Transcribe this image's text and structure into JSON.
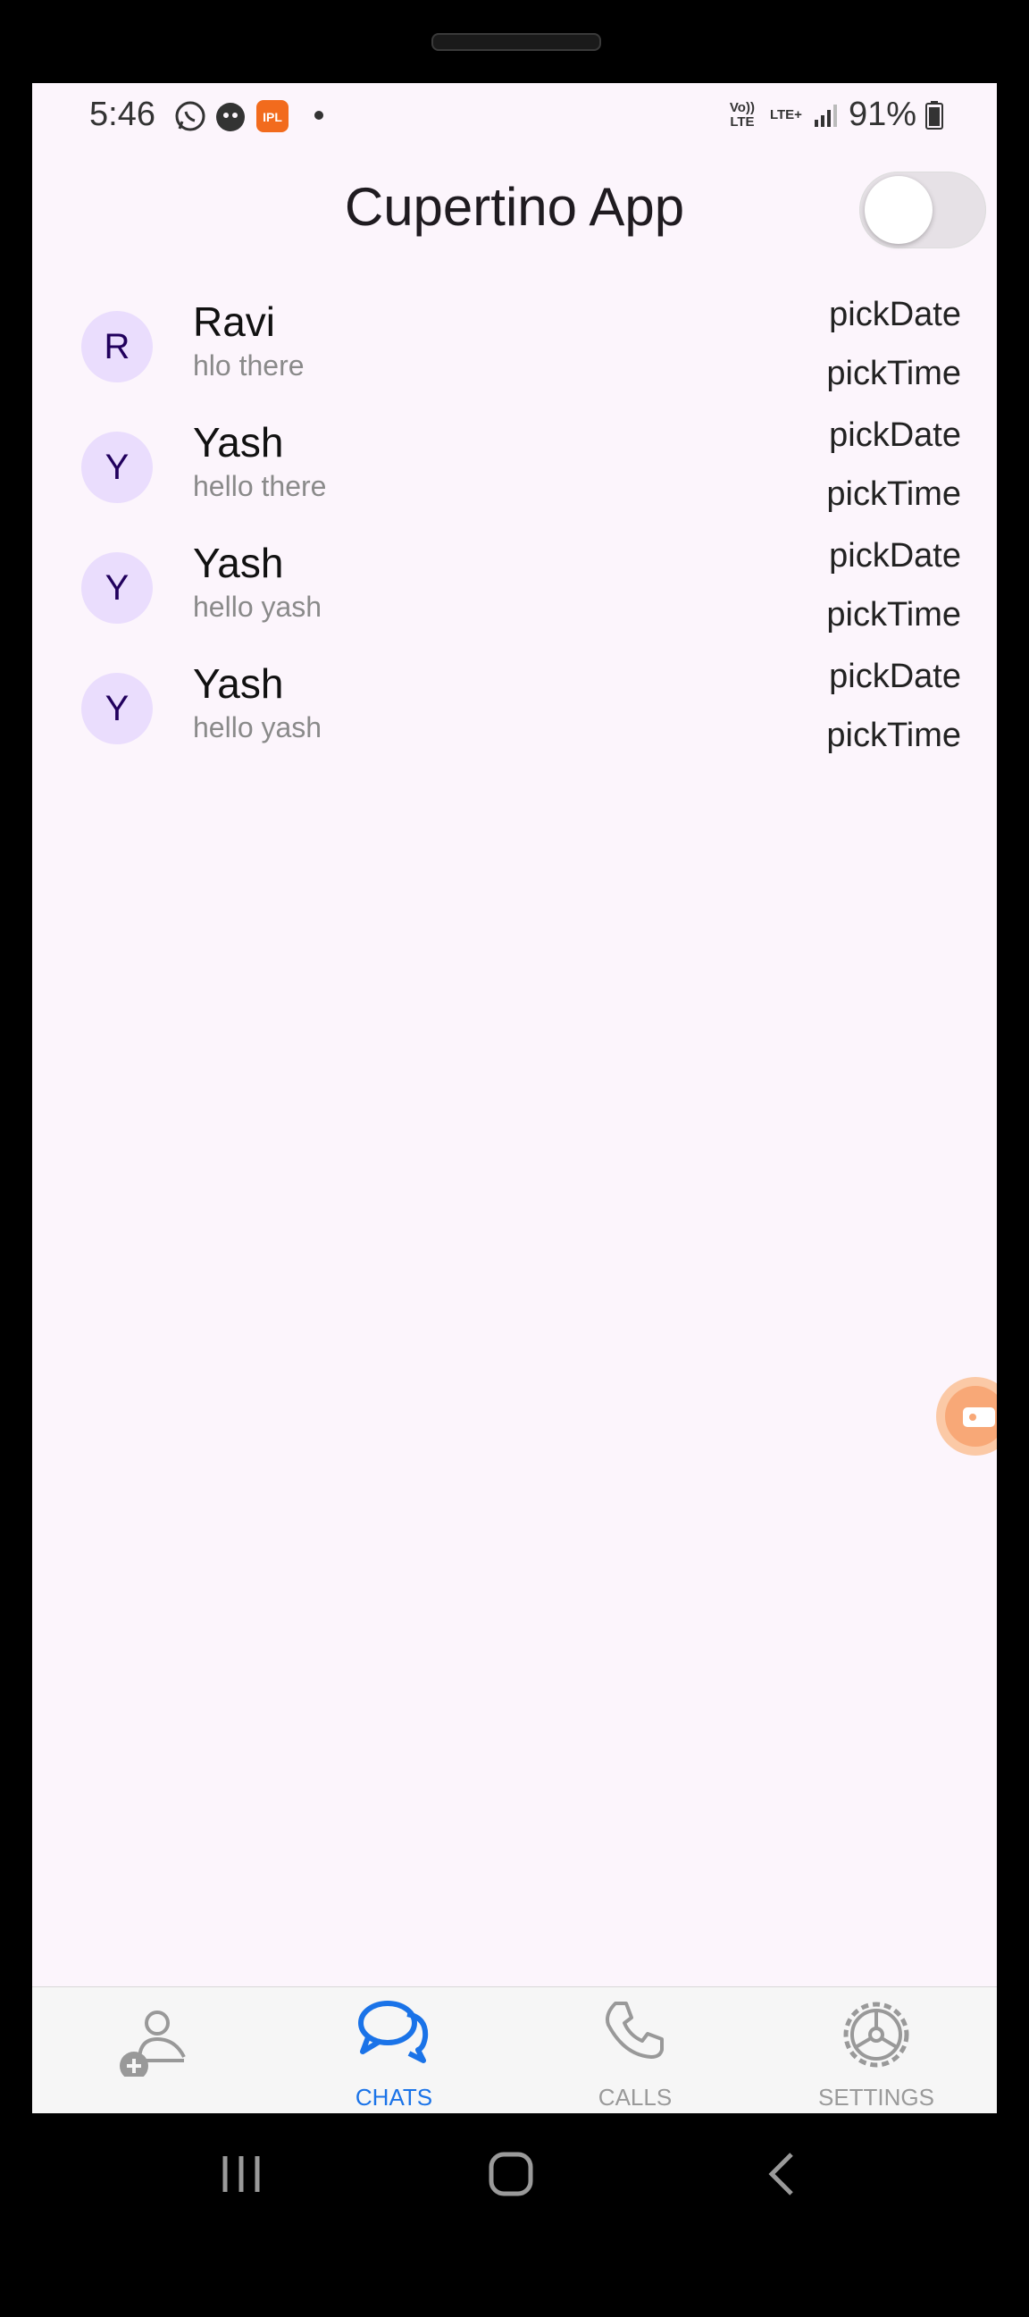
{
  "status_bar": {
    "time": "5:46",
    "icons": [
      "whatsapp-icon",
      "app-notification-icon",
      "ipl-app-icon"
    ],
    "network_1": "Vo)) LTE",
    "network_2": "LTE+",
    "battery": "91%"
  },
  "app_bar": {
    "title": "Cupertino App",
    "toggle_on": false
  },
  "chats": [
    {
      "initial": "R",
      "name": "Ravi",
      "message": "hlo there",
      "date_label": "pickDate",
      "time_label": "pickTime"
    },
    {
      "initial": "Y",
      "name": "Yash",
      "message": "hello there",
      "date_label": "pickDate",
      "time_label": "pickTime"
    },
    {
      "initial": "Y",
      "name": "Yash",
      "message": "hello yash",
      "date_label": "pickDate",
      "time_label": "pickTime"
    },
    {
      "initial": "Y",
      "name": "Yash",
      "message": "hello yash",
      "date_label": "pickDate",
      "time_label": "pickTime"
    }
  ],
  "tabs": [
    {
      "label": "",
      "icon": "add-person-icon",
      "active": false
    },
    {
      "label": "CHATS",
      "icon": "chat-bubbles-icon",
      "active": true
    },
    {
      "label": "CALLS",
      "icon": "phone-icon",
      "active": false
    },
    {
      "label": "SETTINGS",
      "icon": "gear-icon",
      "active": false
    }
  ],
  "colors": {
    "background": "#fcf5fc",
    "accent": "#1a73e8",
    "avatar_bg": "#eaddfd",
    "avatar_text": "#21005d",
    "inactive_tab": "#9a9a9a"
  }
}
